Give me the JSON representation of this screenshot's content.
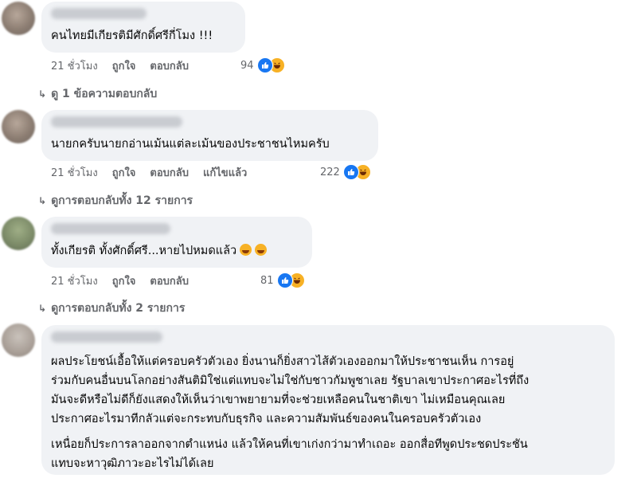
{
  "comments": [
    {
      "text": "คนไทยมีเกียรติมีศักดิ์ศรีกี่โมง !!!",
      "time": "21 ชั่วโมง",
      "like": "ถูกใจ",
      "reply": "ตอบกลับ",
      "reaction_count": "94",
      "reaction_icons": [
        "like-icon",
        "haha-icon"
      ],
      "view_replies": "ดู 1 ข้อความตอบกลับ"
    },
    {
      "text": "นายกครับนายกอ่านเม้นแต่ละเม้นของประชาชนไหมครับ",
      "time": "21 ชั่วโมง",
      "like": "ถูกใจ",
      "reply": "ตอบกลับ",
      "edited": "แก้ไขแล้ว",
      "reaction_count": "222",
      "reaction_icons": [
        "like-icon",
        "haha-icon"
      ],
      "view_replies": "ดูการตอบกลับทั้ง 12 รายการ"
    },
    {
      "text": "ทั้งเกียรติ ทั้งศักดิ์ศรี...หายไปหมดแล้ว",
      "emoji_icons": [
        "weary-face-icon",
        "weary-face-icon"
      ],
      "time": "21 ชั่วโมง",
      "like": "ถูกใจ",
      "reply": "ตอบกลับ",
      "reaction_count": "81",
      "reaction_icons": [
        "like-icon",
        "haha-icon"
      ],
      "view_replies": "ดูการตอบกลับทั้ง 2 รายการ"
    },
    {
      "lines_p1": [
        "ผลประโยชน์เอื้อให้แต่ครอบครัวตัวเอง ยิ่งนานก็ยิ่งสาวไส้ตัวเองออกมาให้ประชาชนเห็น การอยู่",
        "ร่วมกับคนอื่นบนโลกอย่างสันติมิใช่แต่แทบจะไม่ใช่กับชาวกัมพูชาเลย รัฐบาลเขาประกาศอะไรที่ถึง",
        "มันจะดีหรือไม่ดีก็ยังแสดงให้เห็นว่าเขาพยายามที่จะช่วยเหลือคนในชาติเขา ไม่เหมือนคุณเลย",
        "ประกาศอะไรมาทีกลัวแต่จะกระทบกับธุรกิจ และความสัมพันธ์ของคนในครอบครัวตัวเอง"
      ],
      "lines_p2": [
        "เหนื่อยก็ประการลาออกจากตำแหน่ง แล้วให้คนที่เขาเก่งกว่ามาทำเถอะ ออกสื่อทีพูดประชดประชัน",
        "แทบจะหาวุฒิภาวะอะไรไม่ได้เลย"
      ]
    }
  ],
  "colors": {
    "bubble": "#f0f2f5",
    "meta_text": "#65676b",
    "like_blue": "#1877f2",
    "haha_yellow": "#f7b125"
  }
}
